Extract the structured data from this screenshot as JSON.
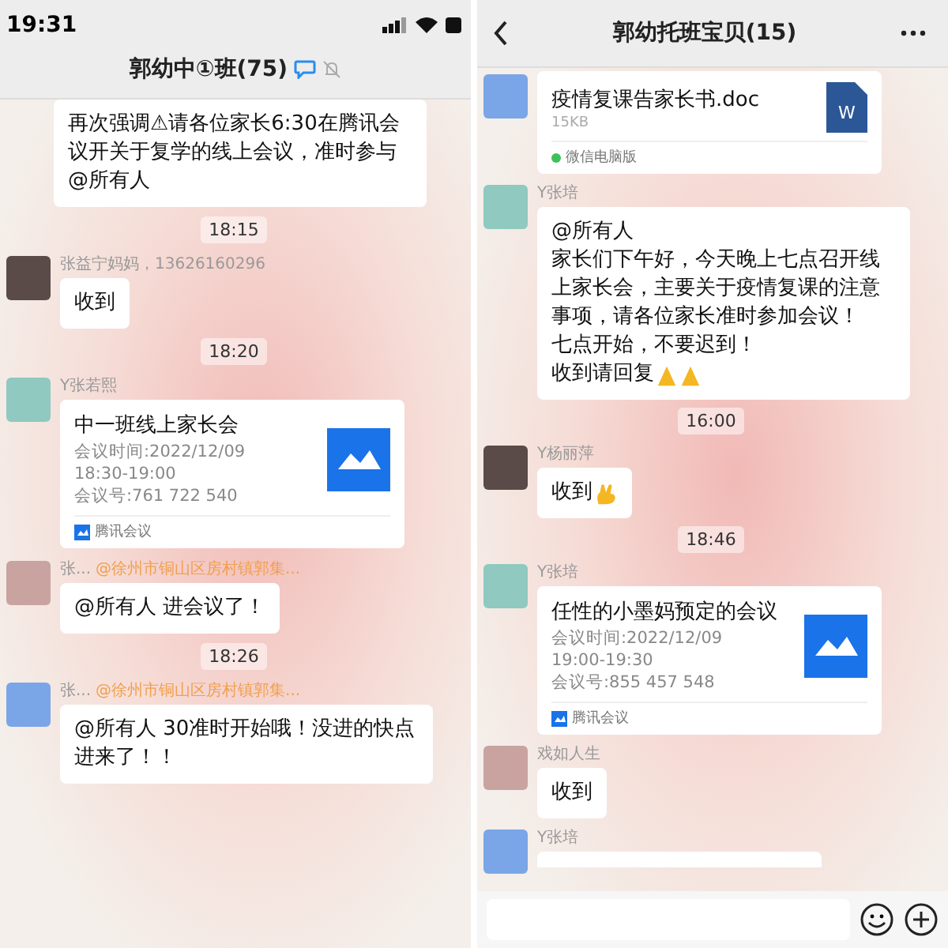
{
  "left_chat": {
    "status_bar": {
      "time": "19:31"
    },
    "title": "郭幼中①班(75)",
    "messages": [
      {
        "kind": "continued_text",
        "paragraphs": [
          "再次强调⚠请各位家长6:30在腾讯会议开关于复学的线上会议，准时参与 @所有人"
        ]
      },
      {
        "kind": "time",
        "text": "18:15"
      },
      {
        "kind": "text",
        "sender": "张益宁妈妈，13626160296",
        "paragraphs": [
          "收到"
        ]
      },
      {
        "kind": "time",
        "text": "18:20"
      },
      {
        "kind": "meeting",
        "sender": "Y张若熙",
        "title": "中一班线上家长会",
        "lines": [
          "会议时间:2022/12/09",
          "18:30-19:00",
          "会议号:761 722 540"
        ],
        "app": "腾讯会议"
      },
      {
        "kind": "text",
        "sender": "张...",
        "tag": "@徐州市铜山区房村镇郭集...",
        "paragraphs": [
          "@所有人 进会议了！"
        ]
      },
      {
        "kind": "time",
        "text": "18:26"
      },
      {
        "kind": "text",
        "sender": "张...",
        "tag": "@徐州市铜山区房村镇郭集...",
        "paragraphs": [
          "@所有人 30准时开始哦！没进的快点进来了！！"
        ]
      }
    ]
  },
  "right_chat": {
    "title": "郭幼托班宝贝(15)",
    "messages": [
      {
        "kind": "file",
        "name": "疫情复课告家长书.doc",
        "size": "15KB",
        "file_icon_letter": "W",
        "source": "微信电脑版"
      },
      {
        "kind": "text",
        "sender": "Y张培",
        "paragraphs": [
          "@所有人",
          "家长们下午好，今天晚上七点召开线上家长会，主要关于疫情复课的注意事项，请各位家长准时参加会议！",
          "七点开始，不要迟到！",
          "收到请回复"
        ],
        "trailing_icons": [
          {
            "kind": "pray"
          },
          {
            "kind": "pray"
          }
        ]
      },
      {
        "kind": "time",
        "text": "16:00"
      },
      {
        "kind": "text",
        "sender": "Y杨丽萍",
        "paragraphs": [
          "收到"
        ],
        "trailing_icons": [
          {
            "kind": "ok"
          }
        ]
      },
      {
        "kind": "time",
        "text": "18:46"
      },
      {
        "kind": "meeting",
        "sender": "Y张培",
        "title": "任性的小墨妈预定的会议",
        "lines": [
          "会议时间:2022/12/09",
          "19:00-19:30",
          "会议号:855 457 548"
        ],
        "app": "腾讯会议"
      },
      {
        "kind": "text",
        "sender": "戏如人生",
        "paragraphs": [
          "收到"
        ]
      },
      {
        "kind": "stub",
        "sender": "Y张培"
      }
    ]
  }
}
